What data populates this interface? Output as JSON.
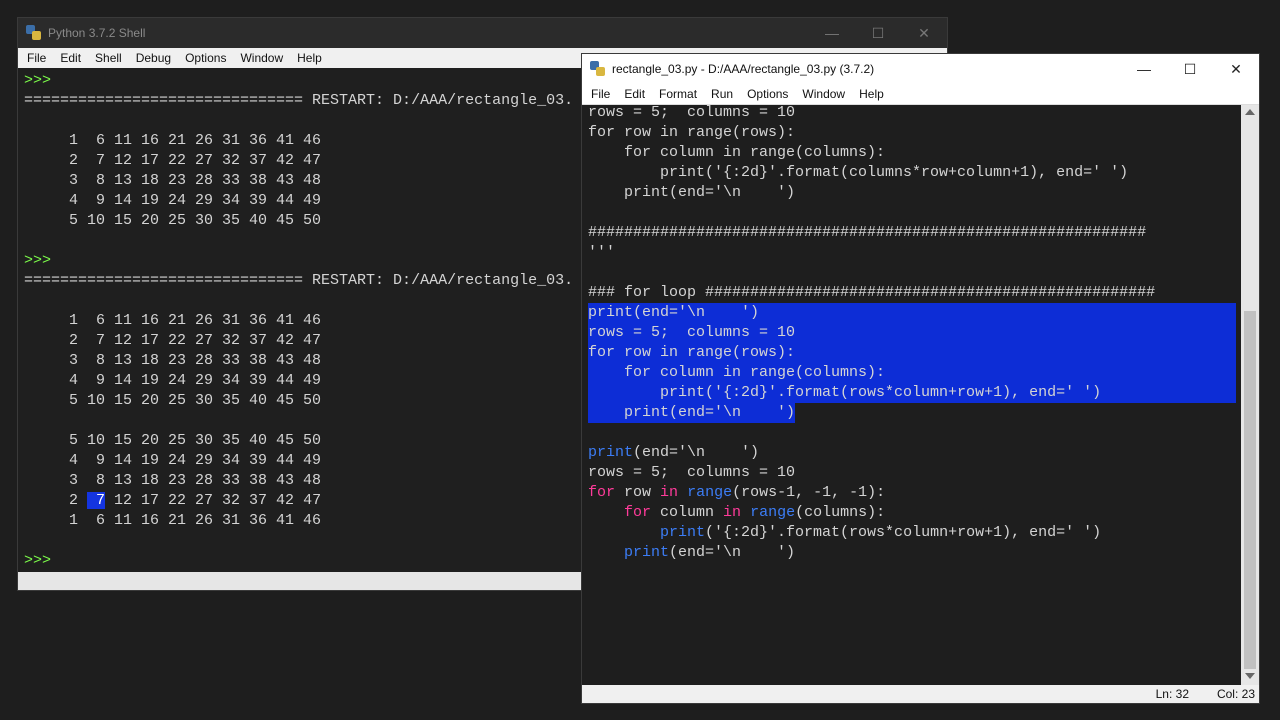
{
  "shell": {
    "title": "Python 3.7.2 Shell",
    "menu": [
      "File",
      "Edit",
      "Shell",
      "Debug",
      "Options",
      "Window",
      "Help"
    ],
    "lines": [
      {
        "t": "prompt",
        "text": ">>>"
      },
      {
        "t": "out",
        "text": "=============================== RESTART: D:/AAA/rectangle_03."
      },
      {
        "t": "out",
        "text": ""
      },
      {
        "t": "out",
        "text": "     1  6 11 16 21 26 31 36 41 46"
      },
      {
        "t": "out",
        "text": "     2  7 12 17 22 27 32 37 42 47"
      },
      {
        "t": "out",
        "text": "     3  8 13 18 23 28 33 38 43 48"
      },
      {
        "t": "out",
        "text": "     4  9 14 19 24 29 34 39 44 49"
      },
      {
        "t": "out",
        "text": "     5 10 15 20 25 30 35 40 45 50"
      },
      {
        "t": "out",
        "text": ""
      },
      {
        "t": "prompt",
        "text": ">>>"
      },
      {
        "t": "out",
        "text": "=============================== RESTART: D:/AAA/rectangle_03."
      },
      {
        "t": "out",
        "text": ""
      },
      {
        "t": "out",
        "text": "     1  6 11 16 21 26 31 36 41 46"
      },
      {
        "t": "out",
        "text": "     2  7 12 17 22 27 32 37 42 47"
      },
      {
        "t": "out",
        "text": "     3  8 13 18 23 28 33 38 43 48"
      },
      {
        "t": "out",
        "text": "     4  9 14 19 24 29 34 39 44 49"
      },
      {
        "t": "out",
        "text": "     5 10 15 20 25 30 35 40 45 50"
      },
      {
        "t": "out",
        "text": ""
      },
      {
        "t": "out",
        "text": "     5 10 15 20 25 30 35 40 45 50"
      },
      {
        "t": "out",
        "text": "     4  9 14 19 24 29 34 39 44 49"
      },
      {
        "t": "out",
        "text": "     3  8 13 18 23 28 33 38 43 48"
      },
      {
        "t": "hl",
        "pre": "     2 ",
        "sel": " 7",
        "post": " 12 17 22 27 32 37 42 47"
      },
      {
        "t": "out",
        "text": "     1  6 11 16 21 26 31 36 41 46"
      },
      {
        "t": "out",
        "text": ""
      },
      {
        "t": "prompt",
        "text": ">>>"
      }
    ]
  },
  "editor": {
    "title": "rectangle_03.py - D:/AAA/rectangle_03.py (3.7.2)",
    "menu": [
      "File",
      "Edit",
      "Format",
      "Run",
      "Options",
      "Window",
      "Help"
    ],
    "status": {
      "ln": "Ln: 32",
      "col": "Col: 23"
    },
    "lines": [
      {
        "sel": false,
        "seg": [
          {
            "c": "p",
            "t": "rows = 5;  columns = 10"
          }
        ]
      },
      {
        "sel": false,
        "seg": [
          {
            "c": "p",
            "t": "for row in range(rows):"
          }
        ]
      },
      {
        "sel": false,
        "seg": [
          {
            "c": "p",
            "t": "    for column in range(columns):"
          }
        ]
      },
      {
        "sel": false,
        "seg": [
          {
            "c": "p",
            "t": "        print('{:2d}'.format(columns*row+column+1), end=' ')"
          }
        ]
      },
      {
        "sel": false,
        "seg": [
          {
            "c": "p",
            "t": "    print(end='\\n    ')"
          }
        ]
      },
      {
        "sel": false,
        "seg": [
          {
            "c": "p",
            "t": ""
          }
        ]
      },
      {
        "sel": false,
        "seg": [
          {
            "c": "p",
            "t": "##############################################################"
          }
        ]
      },
      {
        "sel": false,
        "seg": [
          {
            "c": "p",
            "t": "'''"
          }
        ]
      },
      {
        "sel": false,
        "seg": [
          {
            "c": "p",
            "t": ""
          }
        ]
      },
      {
        "sel": false,
        "seg": [
          {
            "c": "p",
            "t": "### for loop ##################################################"
          }
        ]
      },
      {
        "sel": true,
        "seg": [
          {
            "c": "p",
            "t": "print(end='\\n    ')"
          }
        ]
      },
      {
        "sel": true,
        "seg": [
          {
            "c": "p",
            "t": "rows = 5;  columns = 10"
          }
        ]
      },
      {
        "sel": true,
        "seg": [
          {
            "c": "p",
            "t": "for row in range(rows):"
          }
        ]
      },
      {
        "sel": true,
        "seg": [
          {
            "c": "p",
            "t": "    for column in range(columns):"
          }
        ]
      },
      {
        "sel": true,
        "seg": [
          {
            "c": "p",
            "t": "        print('{:2d}'.format(rows*column+row+1), end=' ')"
          }
        ]
      },
      {
        "sel": "partial",
        "seg": [
          {
            "c": "p",
            "t": "    print(end='\\n    ')"
          }
        ]
      },
      {
        "sel": false,
        "seg": [
          {
            "c": "p",
            "t": ""
          }
        ]
      },
      {
        "sel": false,
        "seg": [
          {
            "c": "bi",
            "t": "print"
          },
          {
            "c": "p",
            "t": "(end='\\n    ')"
          }
        ]
      },
      {
        "sel": false,
        "seg": [
          {
            "c": "p",
            "t": "rows = 5;  columns = 10"
          }
        ]
      },
      {
        "sel": false,
        "seg": [
          {
            "c": "kw",
            "t": "for"
          },
          {
            "c": "p",
            "t": " row "
          },
          {
            "c": "kw",
            "t": "in"
          },
          {
            "c": "p",
            "t": " "
          },
          {
            "c": "bi",
            "t": "range"
          },
          {
            "c": "p",
            "t": "(rows-1, -1, -1):"
          }
        ]
      },
      {
        "sel": false,
        "seg": [
          {
            "c": "p",
            "t": "    "
          },
          {
            "c": "kw",
            "t": "for"
          },
          {
            "c": "p",
            "t": " column "
          },
          {
            "c": "kw",
            "t": "in"
          },
          {
            "c": "p",
            "t": " "
          },
          {
            "c": "bi",
            "t": "range"
          },
          {
            "c": "p",
            "t": "(columns):"
          }
        ]
      },
      {
        "sel": false,
        "seg": [
          {
            "c": "p",
            "t": "        "
          },
          {
            "c": "bi",
            "t": "print"
          },
          {
            "c": "p",
            "t": "('{:2d}'.format(rows*column+row+1), end=' ')"
          }
        ]
      },
      {
        "sel": false,
        "seg": [
          {
            "c": "p",
            "t": "    "
          },
          {
            "c": "bi",
            "t": "print"
          },
          {
            "c": "p",
            "t": "(end='\\n    ')"
          }
        ]
      }
    ]
  },
  "colors": {
    "accent": "#0d2dd6",
    "keyword": "#ff3b9a",
    "builtin": "#3c7df6",
    "prompt": "#7cfc4a"
  }
}
